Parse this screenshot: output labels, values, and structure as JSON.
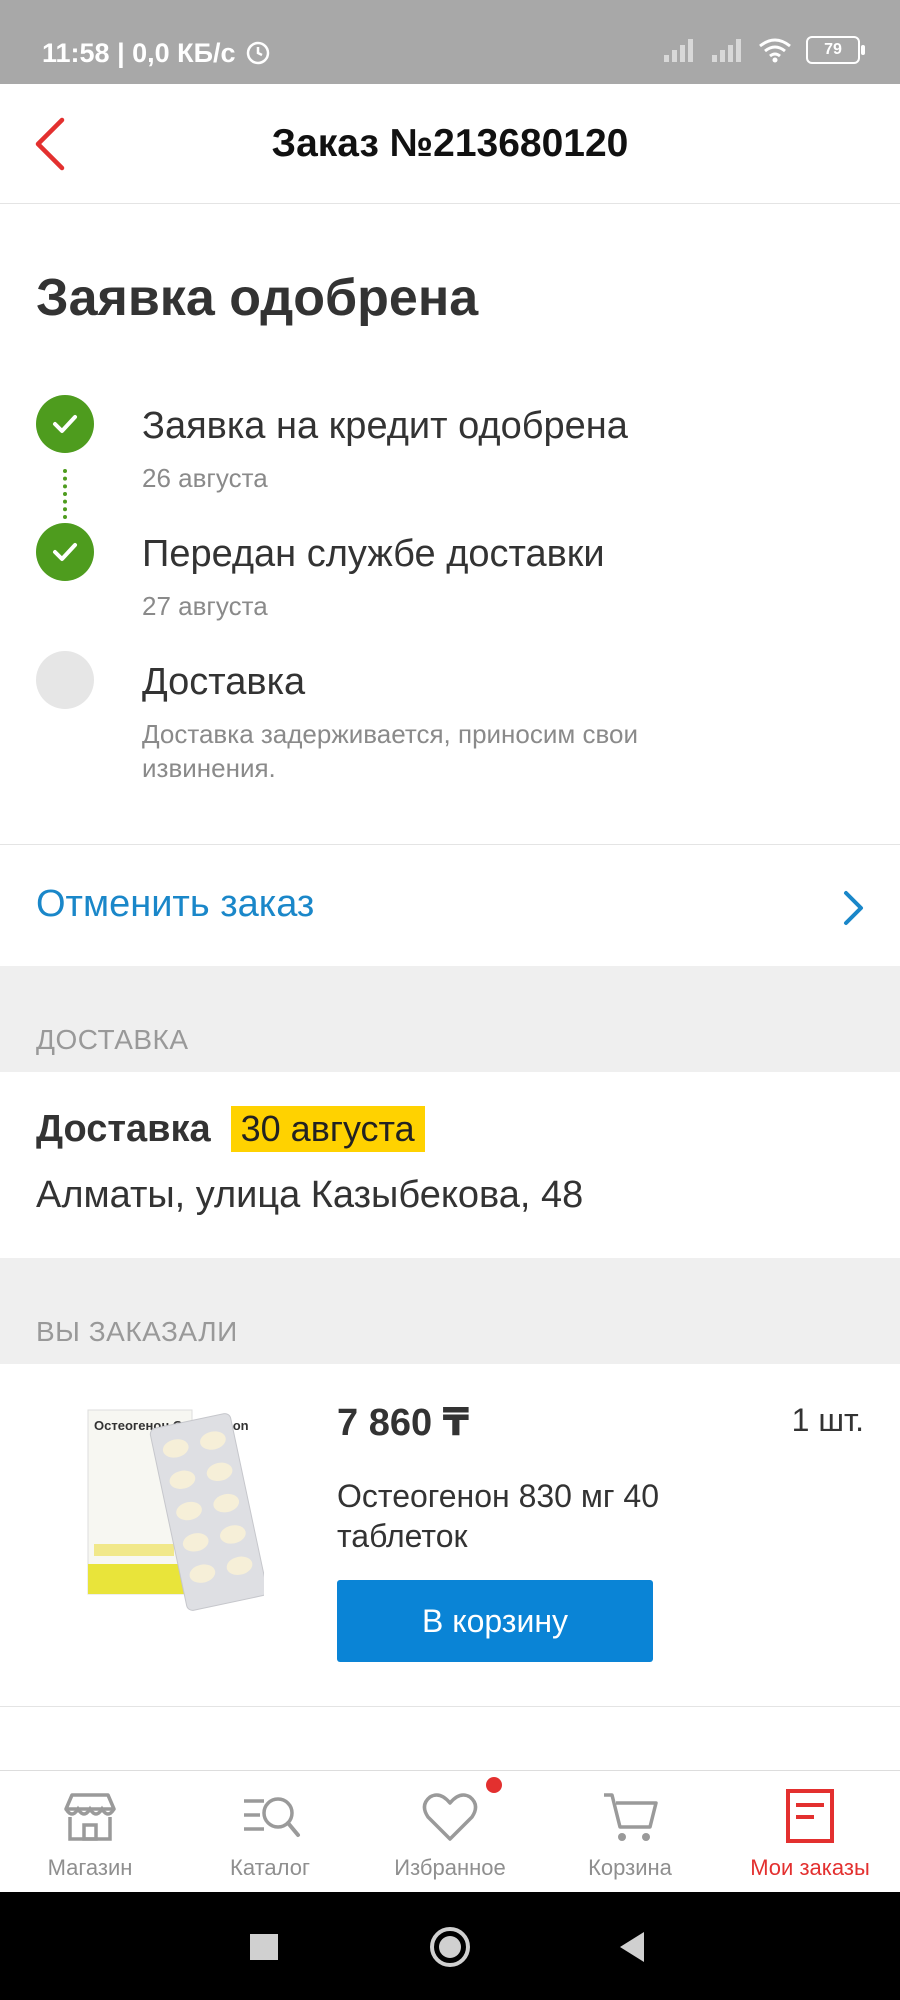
{
  "status_bar": {
    "time": "11:58 | 0,0 КБ/с",
    "battery": "79",
    "icons": [
      "alarm-icon",
      "signal-icon",
      "signal-icon",
      "wifi-icon",
      "battery-icon"
    ]
  },
  "header": {
    "title": "Заказ №213680120",
    "back_icon": "chevron-left-icon"
  },
  "order_status": {
    "title": "Заявка одобрена",
    "steps": [
      {
        "label": "Заявка на кредит одобрена",
        "date": "26 августа",
        "done": true
      },
      {
        "label": "Передан службе доставки",
        "date": "27 августа",
        "done": true
      },
      {
        "label": "Доставка",
        "date": "Доставка задерживается, приносим свои извинения.",
        "done": false
      }
    ]
  },
  "cancel": {
    "label": "Отменить заказ"
  },
  "delivery": {
    "section_title": "ДОСТАВКА",
    "label": "Доставка",
    "date": "30 августа",
    "address": "Алматы, улица Казыбекова, 48"
  },
  "ordered": {
    "section_title": "ВЫ ЗАКАЗАЛИ",
    "items": [
      {
        "price": "7 860 ₸",
        "quantity": "1 шт.",
        "name": "Остеогенон 830 мг 40 таблеток",
        "button": "В корзину",
        "image_text": "Остеогенон Osteogenon"
      }
    ]
  },
  "bottom_nav": {
    "items": [
      {
        "label": "Магазин",
        "icon": "store-icon",
        "active": false
      },
      {
        "label": "Каталог",
        "icon": "catalog-search-icon",
        "active": false
      },
      {
        "label": "Избранное",
        "icon": "heart-icon",
        "active": false,
        "badge": true
      },
      {
        "label": "Корзина",
        "icon": "cart-icon",
        "active": false
      },
      {
        "label": "Мои заказы",
        "icon": "orders-icon",
        "active": true
      }
    ]
  },
  "colors": {
    "accent_red": "#e3302f",
    "link_blue": "#1a87c9",
    "button_blue": "#0a84d6",
    "success_green": "#4e9c1e",
    "highlight_yellow": "#ffd200"
  }
}
